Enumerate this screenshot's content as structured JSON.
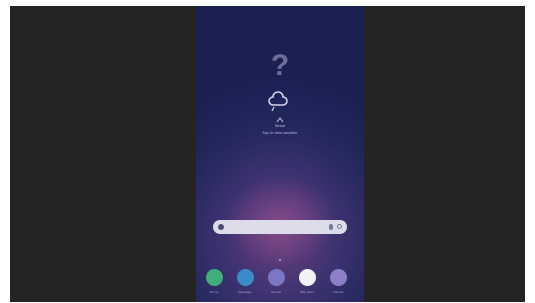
{
  "screen": {
    "weather": {
      "location": "Seoul",
      "detail": "Tap to view weather"
    },
    "search": {
      "placeholder": ""
    },
    "dock": [
      {
        "label": "Phone",
        "icon": "phone-icon",
        "color": "#3fae7a"
      },
      {
        "label": "Messages",
        "icon": "messages-icon",
        "color": "#3a8cc9"
      },
      {
        "label": "Internet",
        "icon": "internet-icon",
        "color": "#7a78c4"
      },
      {
        "label": "Play Store",
        "icon": "play-store-icon",
        "color": "#f2f2f6"
      },
      {
        "label": "Camera",
        "icon": "camera-icon",
        "color": "#8c7fc8"
      }
    ]
  },
  "colors": {
    "frame": "#262323",
    "wallpaper_top": "#1b1f52",
    "wallpaper_glow": "#6a3f7c"
  }
}
